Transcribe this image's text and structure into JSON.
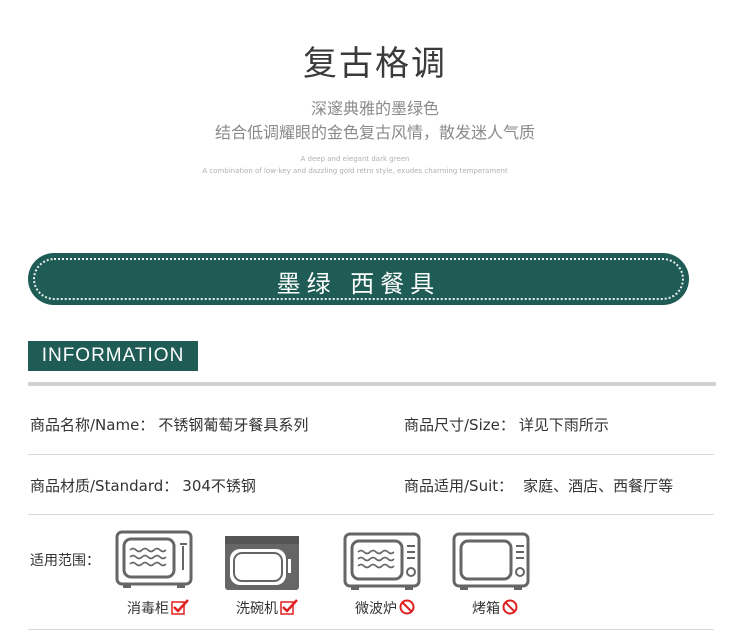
{
  "header": {
    "title": "复古格调",
    "subtitle_line1": "深邃典雅的墨绿色",
    "subtitle_line2": "结合低调耀眼的金色复古风情，散发迷人气质",
    "english_line1": "A deep and elegant dark green",
    "english_line2": "A combination of low-key and dazzling gold retro style, exudes charming temperament"
  },
  "banner": {
    "text": "墨绿 西餐具"
  },
  "information": {
    "label": "INFORMATION",
    "name_label": "商品名称/Name：",
    "name_value": "不锈钢葡萄牙餐具系列",
    "size_label": "商品尺寸/Size：",
    "size_value": "详见下雨所示",
    "material_label": "商品材质/Standard：",
    "material_value": "304不锈钢",
    "suit_label": "商品适用/Suit：",
    "suit_value": "家庭、酒店、西餐厅等"
  },
  "usage": {
    "label": "适用范围：",
    "items": [
      {
        "name": "消毒柜",
        "allowed": true,
        "icon": "disinfection-cabinet-icon"
      },
      {
        "name": "洗碗机",
        "allowed": true,
        "icon": "dishwasher-icon"
      },
      {
        "name": "微波炉",
        "allowed": false,
        "icon": "microwave-icon"
      },
      {
        "name": "烤箱",
        "allowed": false,
        "icon": "oven-icon"
      }
    ]
  },
  "colors": {
    "brand_green": "#1f5c56",
    "check_red": "#e02020",
    "forbid_red": "#e02020"
  }
}
